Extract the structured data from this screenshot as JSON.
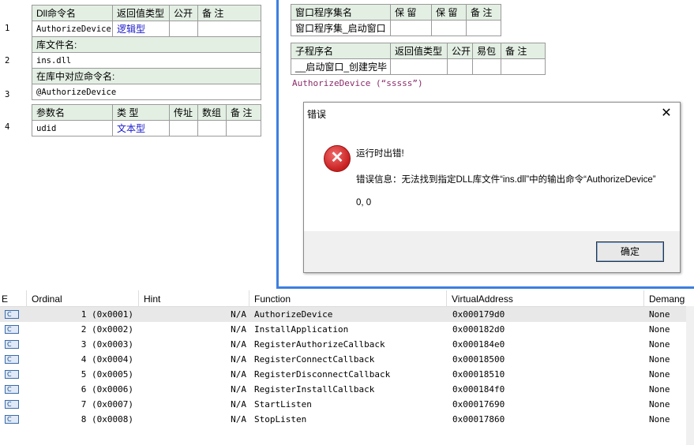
{
  "left_panel": {
    "row1": {
      "headers": [
        "Dll命令名",
        "返回值类型",
        "公开",
        "备 注"
      ],
      "values": [
        "AuthorizeDevice",
        "逻辑型",
        "",
        ""
      ]
    },
    "lib_label": "库文件名:",
    "lib_value": "ins.dll",
    "cmd_label": "在库中对应命令名:",
    "cmd_value": "@AuthorizeDevice",
    "params": {
      "headers": [
        "参数名",
        "类 型",
        "传址",
        "数组",
        "备 注"
      ],
      "values": [
        "udid",
        "文本型",
        "",
        "",
        ""
      ]
    },
    "line_numbers": [
      "1",
      "2",
      "3",
      "4"
    ]
  },
  "right_panel": {
    "top_table": {
      "headers": [
        "窗口程序集名",
        "保 留",
        "保 留",
        "备 注"
      ],
      "values": [
        "窗口程序集_启动窗口",
        "",
        "",
        ""
      ]
    },
    "sub_table": {
      "headers": [
        "子程序名",
        "返回值类型",
        "公开",
        "易包",
        "备 注"
      ],
      "values": [
        "__启动窗口_创建完毕",
        "",
        "",
        "",
        ""
      ]
    },
    "code_line": "AuthorizeDevice (“sssss”)"
  },
  "dialog": {
    "title": "错误",
    "close": "✕",
    "line1": "运行时出错!",
    "line2": "错误信息：无法找到指定DLL库文件“ins.dll”中的输出命令“AuthorizeDevice”",
    "line3": "0, 0",
    "ok": "确定",
    "icon": "error-x-icon"
  },
  "grid": {
    "columns": [
      "E",
      "Ordinal",
      "Hint",
      "Function",
      "VirtualAddress",
      "Demang"
    ],
    "rows": [
      {
        "icon": "C",
        "ordinal": "1 (0x0001)",
        "hint": "N/A",
        "function": "AuthorizeDevice",
        "va": "0x000179d0",
        "demangled": "None"
      },
      {
        "icon": "C",
        "ordinal": "2 (0x0002)",
        "hint": "N/A",
        "function": "InstallApplication",
        "va": "0x000182d0",
        "demangled": "None"
      },
      {
        "icon": "C",
        "ordinal": "3 (0x0003)",
        "hint": "N/A",
        "function": "RegisterAuthorizeCallback",
        "va": "0x000184e0",
        "demangled": "None"
      },
      {
        "icon": "C",
        "ordinal": "4 (0x0004)",
        "hint": "N/A",
        "function": "RegisterConnectCallback",
        "va": "0x00018500",
        "demangled": "None"
      },
      {
        "icon": "C",
        "ordinal": "5 (0x0005)",
        "hint": "N/A",
        "function": "RegisterDisconnectCallback",
        "va": "0x00018510",
        "demangled": "None"
      },
      {
        "icon": "C",
        "ordinal": "6 (0x0006)",
        "hint": "N/A",
        "function": "RegisterInstallCallback",
        "va": "0x000184f0",
        "demangled": "None"
      },
      {
        "icon": "C",
        "ordinal": "7 (0x0007)",
        "hint": "N/A",
        "function": "StartListen",
        "va": "0x00017690",
        "demangled": "None"
      },
      {
        "icon": "C",
        "ordinal": "8 (0x0008)",
        "hint": "N/A",
        "function": "StopListen",
        "va": "0x00017860",
        "demangled": "None"
      }
    ]
  },
  "colors": {
    "header_bg": "#e4efe4",
    "accent_blue": "#3d7fe0",
    "type_blue": "#1a1acc"
  }
}
